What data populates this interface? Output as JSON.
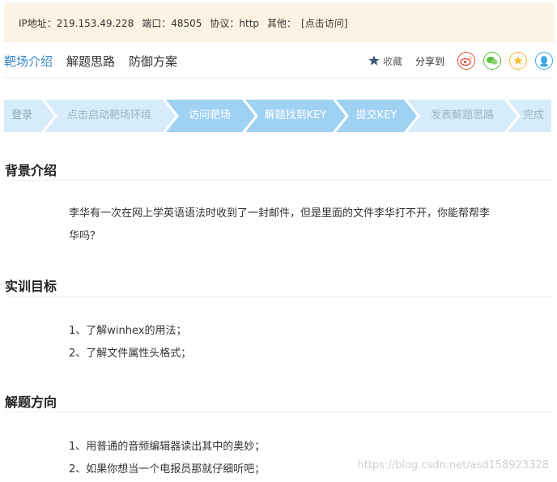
{
  "info": {
    "ip": "IP地址：219.153.49.228",
    "port": "端口：48505",
    "protocol": "协议：http",
    "other_label": "其他：",
    "visit_link": "[点击访问]"
  },
  "nav": {
    "tabs": [
      {
        "label": "靶场介绍",
        "active": true
      },
      {
        "label": "解题思路",
        "active": false
      },
      {
        "label": "防御方案",
        "active": false
      }
    ],
    "favorite_label": "收藏",
    "share_label": "分享到",
    "share_icons": [
      "weibo-icon",
      "wechat-icon",
      "qzone-icon",
      "qq-icon"
    ]
  },
  "steps": [
    {
      "label": "登录",
      "done": false
    },
    {
      "label": "点击启动靶场环境",
      "done": false
    },
    {
      "label": "访问靶场",
      "done": true
    },
    {
      "label": "解题找到KEY",
      "done": true
    },
    {
      "label": "提交KEY",
      "done": true
    },
    {
      "label": "发表解题思路",
      "done": false
    },
    {
      "label": "完成",
      "done": false
    }
  ],
  "colors": {
    "step_done": "#9fd1f2",
    "step_todo": "#d6ecfb",
    "accent": "#3a87c8",
    "info_bg": "#fdf3e4"
  },
  "sections": {
    "background": {
      "title": "背景介绍",
      "text": "李华有一次在网上学英语语法时收到了一封邮件，但是里面的文件李华打不开，你能帮帮李华吗？"
    },
    "goals": {
      "title": "实训目标",
      "items": [
        "1、了解winhex的用法；",
        "2、了解文件属性头格式；"
      ]
    },
    "direction": {
      "title": "解题方向",
      "items": [
        "1、用普通的音频编辑器读出其中的奥妙；",
        "2、如果你想当一个电报员那就仔细听吧；"
      ]
    }
  },
  "watermark": "https://blog.csdn.net/asd158923328"
}
